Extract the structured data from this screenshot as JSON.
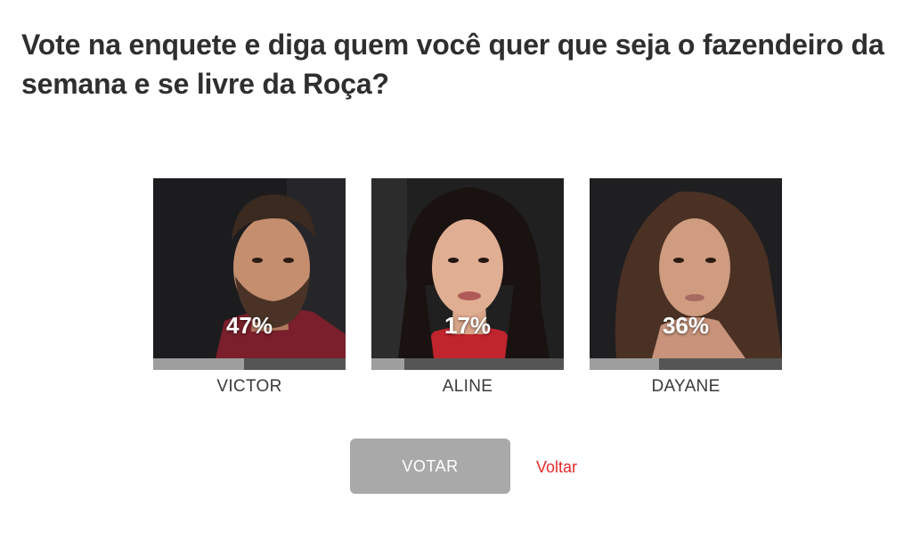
{
  "poll": {
    "question": "Vote na enquete e diga quem você quer que seja o fazendeiro da semana e se livre da Roça?",
    "options": [
      {
        "name": "VICTOR",
        "percent_label": "47%",
        "percent": 47,
        "photo": "victor-photo"
      },
      {
        "name": "ALINE",
        "percent_label": "17%",
        "percent": 17,
        "photo": "aline-photo"
      },
      {
        "name": "DAYANE",
        "percent_label": "36%",
        "percent": 36,
        "photo": "dayane-photo"
      }
    ],
    "vote_label": "VOTAR",
    "back_label": "Voltar"
  },
  "colors": {
    "bar_track": "#555555",
    "bar_fill": "#9e9e9e",
    "button_bg": "#a9a9a9",
    "link": "#e32a2a"
  }
}
